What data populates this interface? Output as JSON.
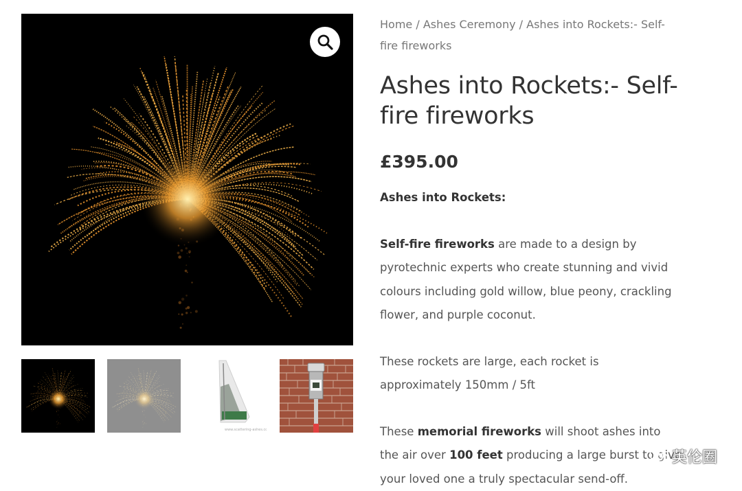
{
  "breadcrumb": {
    "home": "Home",
    "sep1": " / ",
    "category": "Ashes Ceremony",
    "sep2": " / ",
    "current": "Ashes into Rockets:- Self-fire fireworks"
  },
  "product": {
    "title": "Ashes into Rockets:- Self-fire fireworks",
    "price": "£395.00"
  },
  "description": {
    "intro": "Ashes into Rockets:",
    "p1_bold": "Self-fire fireworks",
    "p1_rest": " are made to a design by pyrotechnic experts who create stunning and vivid colours including gold willow, blue peony, crackling flower, and purple coconut.",
    "p2": "These rockets are large, each rocket is approximately 150mm / 5ft",
    "p3_a": "These ",
    "p3_bold1": "memorial fireworks",
    "p3_b": "  will shoot ashes into the air over ",
    "p3_bold2": "100 feet",
    "p3_c": " producing a large burst to give your loved one a truly spectacular send-off."
  },
  "gallery": {
    "zoom_icon": "magnifier-icon",
    "thumbnails": [
      "firework-gold",
      "firework-faded",
      "rocket-product",
      "rocket-on-wall"
    ]
  },
  "watermark": {
    "text": "英伦圈",
    "icon": "wechat-icon"
  },
  "colors": {
    "firework_gold": "#e8a23a",
    "background": "#000000",
    "brick": "#a0523c"
  }
}
